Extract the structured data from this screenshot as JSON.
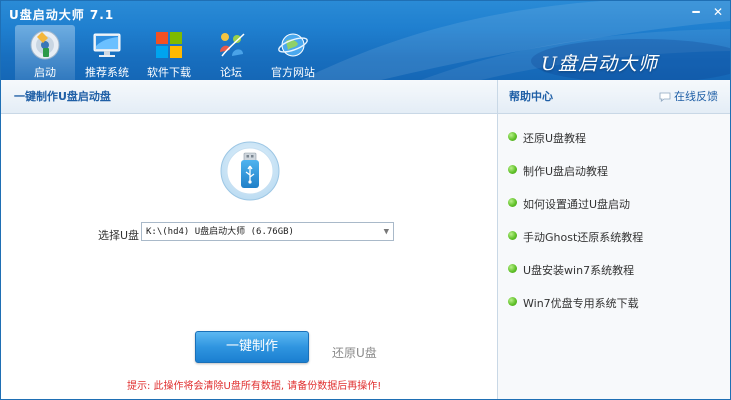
{
  "window": {
    "title": "U盘启动大师 7.1",
    "minimize_glyph": "━",
    "close_glyph": "✕"
  },
  "nav": {
    "items": [
      {
        "label": "启动",
        "icon": "usb-disc-icon",
        "active": true
      },
      {
        "label": "推荐系统",
        "icon": "monitor-icon",
        "active": false
      },
      {
        "label": "软件下载",
        "icon": "windows-logo-icon",
        "active": false
      },
      {
        "label": "论坛",
        "icon": "forum-people-icon",
        "active": false
      },
      {
        "label": "官方网站",
        "icon": "globe-icon",
        "active": false
      }
    ]
  },
  "brand": {
    "logo_text": "U盘启动大师"
  },
  "main": {
    "section_title": "一键制作U盘启动盘",
    "select_label": "选择U盘",
    "drive_value": "K:\\(hd4) U盘启动大师 (6.76GB)",
    "make_button": "一键制作",
    "restore_link": "还原U盘",
    "warning": "提示: 此操作将会清除U盘所有数据, 请备份数据后再操作!"
  },
  "help": {
    "title": "帮助中心",
    "feedback": "在线反馈",
    "items": [
      "还原U盘教程",
      "制作U盘启动教程",
      "如何设置通过U盘启动",
      "手动Ghost还原系统教程",
      "U盘安装win7系统教程",
      "Win7优盘专用系统下载"
    ]
  },
  "colors": {
    "header_blue": "#1f7fcf",
    "panel_title": "#1f5fa6",
    "button_blue": "#2f95e0",
    "warning_red": "#e03030",
    "dot_green": "#62c22a"
  }
}
